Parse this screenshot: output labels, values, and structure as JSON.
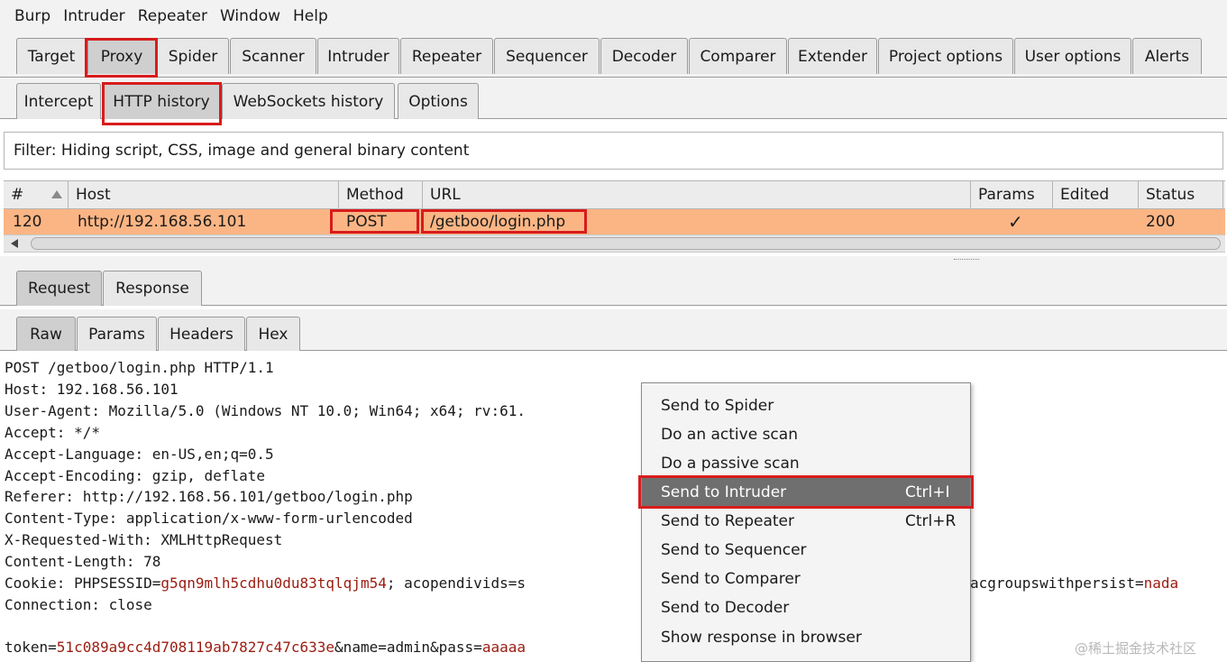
{
  "menu": [
    "Burp",
    "Intruder",
    "Repeater",
    "Window",
    "Help"
  ],
  "main_tabs": [
    "Target",
    "Proxy",
    "Spider",
    "Scanner",
    "Intruder",
    "Repeater",
    "Sequencer",
    "Decoder",
    "Comparer",
    "Extender",
    "Project options",
    "User options",
    "Alerts"
  ],
  "main_tab_active": "Proxy",
  "proxy_tabs": [
    "Intercept",
    "HTTP history",
    "WebSockets history",
    "Options"
  ],
  "proxy_tab_active": "HTTP history",
  "filter_text": "Filter: Hiding script, CSS, image and general binary content",
  "table": {
    "columns": [
      "#",
      "Host",
      "Method",
      "URL",
      "Params",
      "Edited",
      "Status"
    ],
    "rows": [
      {
        "id": "120",
        "host": "http://192.168.56.101",
        "method": "POST",
        "url": "/getboo/login.php",
        "params": "✓",
        "edited": "",
        "status": "200"
      }
    ]
  },
  "message_tabs": [
    "Request",
    "Response"
  ],
  "view_tabs": [
    "Raw",
    "Params",
    "Headers",
    "Hex"
  ],
  "raw_lines": [
    {
      "t": "POST /getboo/login.php HTTP/1.1"
    },
    {
      "t": "Host: 192.168.56.101"
    },
    {
      "t": "User-Agent: Mozilla/5.0 (Windows NT 10.0; Win64; x64; rv:61."
    },
    {
      "t": "Accept: */*"
    },
    {
      "t": "Accept-Language: en-US,en;q=0.5"
    },
    {
      "t": "Accept-Encoding: gzip, deflate"
    },
    {
      "t": "Referer: http://192.168.56.101/getboo/login.php"
    },
    {
      "t": "Content-Type: application/x-www-form-urlencoded"
    },
    {
      "t": "X-Requested-With: XMLHttpRequest"
    },
    {
      "t": "Content-Length: 78"
    },
    {
      "cookie_label": "Cookie: PHPSESSID=",
      "cookie_val": "g5qn9mlh5cdhu0du83tqlqjm54",
      "cookie_rest": "; acopendivids=s",
      "cookie_tail_label": "acgroupswithpersist=",
      "cookie_tail_val": "nada"
    },
    {
      "t": "Connection: close"
    },
    {
      "t": ""
    },
    {
      "body_label": "token=",
      "body_val": "51c089a9cc4d708119ab7827c47c633e",
      "body_rest": "&name=admin&pass=",
      "body_val2": "aaaaa"
    }
  ],
  "context_menu": [
    {
      "label": "Send to Spider",
      "shortcut": ""
    },
    {
      "label": "Do an active scan",
      "shortcut": ""
    },
    {
      "label": "Do a passive scan",
      "shortcut": ""
    },
    {
      "label": "Send to Intruder",
      "shortcut": "Ctrl+I"
    },
    {
      "label": "Send to Repeater",
      "shortcut": "Ctrl+R"
    },
    {
      "label": "Send to Sequencer",
      "shortcut": ""
    },
    {
      "label": "Send to Comparer",
      "shortcut": ""
    },
    {
      "label": "Send to Decoder",
      "shortcut": ""
    },
    {
      "label": "Show response in browser",
      "shortcut": ""
    }
  ],
  "context_menu_selected": "Send to Intruder",
  "highlight_color": "#d81c1c",
  "row_highlight_color": "#fbb584",
  "watermark": "@稀土掘金技术社区"
}
